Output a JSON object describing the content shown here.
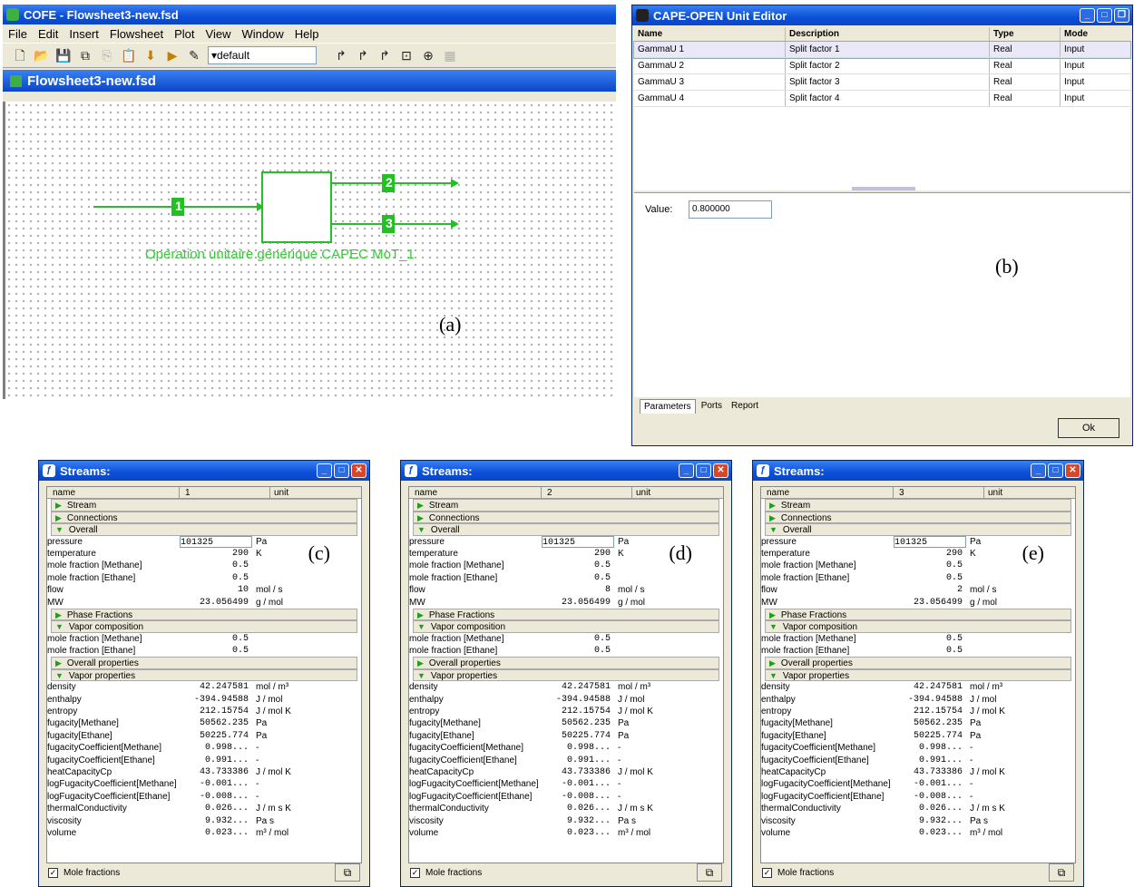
{
  "cofe": {
    "title": "COFE - Flowsheet3-new.fsd",
    "menu": [
      "File",
      "Edit",
      "Insert",
      "Flowsheet",
      "Plot",
      "View",
      "Window",
      "Help"
    ],
    "combo_value": "default",
    "doc_title": "Flowsheet3-new.fsd",
    "unit_label": "Opération unitaire générique CAPEC MoT_1",
    "stream_labels": [
      "1",
      "2",
      "3"
    ],
    "figure_label": "(a)"
  },
  "editor": {
    "title": "CAPE-OPEN Unit Editor",
    "columns": [
      "Name",
      "Description",
      "Type",
      "Mode"
    ],
    "rows": [
      {
        "name": "GammaU 1",
        "description": "Split factor 1",
        "type": "Real",
        "mode": "Input"
      },
      {
        "name": "GammaU 2",
        "description": "Split factor 2",
        "type": "Real",
        "mode": "Input"
      },
      {
        "name": "GammaU 3",
        "description": "Split factor 3",
        "type": "Real",
        "mode": "Input"
      },
      {
        "name": "GammaU 4",
        "description": "Split factor 4",
        "type": "Real",
        "mode": "Input"
      }
    ],
    "value_label": "Value:",
    "value": "0.800000",
    "tabs": [
      "Parameters",
      "Ports",
      "Report"
    ],
    "ok_label": "Ok",
    "figure_label": "(b)"
  },
  "streams": [
    {
      "title": "Streams:",
      "stream_id": "1",
      "figure_label": "(c)",
      "overall": {
        "pressure": "101325",
        "temperature": "290",
        "x_methane": "0.5",
        "x_ethane": "0.5",
        "flow": "10",
        "mw": "23.056499"
      },
      "vapor_comp": {
        "x_methane": "0.5",
        "x_ethane": "0.5"
      }
    },
    {
      "title": "Streams:",
      "stream_id": "2",
      "figure_label": "(d)",
      "overall": {
        "pressure": "101325",
        "temperature": "290",
        "x_methane": "0.5",
        "x_ethane": "0.5",
        "flow": "8",
        "mw": "23.056499"
      },
      "vapor_comp": {
        "x_methane": "0.5",
        "x_ethane": "0.5"
      }
    },
    {
      "title": "Streams:",
      "stream_id": "3",
      "figure_label": "(e)",
      "overall": {
        "pressure": "101325",
        "temperature": "290",
        "x_methane": "0.5",
        "x_ethane": "0.5",
        "flow": "2",
        "mw": "23.056499"
      },
      "vapor_comp": {
        "x_methane": "0.5",
        "x_ethane": "0.5"
      }
    }
  ],
  "stream_common": {
    "header": {
      "name": "name",
      "unit": "unit"
    },
    "sections": {
      "stream": "Stream",
      "connections": "Connections",
      "overall": "Overall",
      "phase_fractions": "Phase Fractions",
      "vapor_composition": "Vapor composition",
      "overall_properties": "Overall properties",
      "vapor_properties": "Vapor properties"
    },
    "overall_rows": [
      {
        "key": "pressure",
        "label": "pressure",
        "unit": "Pa"
      },
      {
        "key": "temperature",
        "label": "temperature",
        "unit": "K"
      },
      {
        "key": "x_methane",
        "label": "mole fraction [Methane]",
        "unit": ""
      },
      {
        "key": "x_ethane",
        "label": "mole fraction [Ethane]",
        "unit": ""
      },
      {
        "key": "flow",
        "label": "flow",
        "unit": "mol / s"
      },
      {
        "key": "mw",
        "label": "MW",
        "unit": "g / mol"
      }
    ],
    "vapor_comp_rows": [
      {
        "key": "x_methane",
        "label": "mole fraction [Methane]"
      },
      {
        "key": "x_ethane",
        "label": "mole fraction [Ethane]"
      }
    ],
    "vapor_props": [
      {
        "label": "density",
        "value": "42.247581",
        "unit": "mol / m³"
      },
      {
        "label": "enthalpy",
        "value": "-394.94588",
        "unit": "J / mol"
      },
      {
        "label": "entropy",
        "value": "212.15754",
        "unit": "J / mol K"
      },
      {
        "label": "fugacity[Methane]",
        "value": "50562.235",
        "unit": "Pa"
      },
      {
        "label": "fugacity[Ethane]",
        "value": "50225.774",
        "unit": "Pa"
      },
      {
        "label": "fugacityCoefficient[Methane]",
        "value": "0.998...",
        "unit": "-"
      },
      {
        "label": "fugacityCoefficient[Ethane]",
        "value": "0.991...",
        "unit": "-"
      },
      {
        "label": "heatCapacityCp",
        "value": "43.733386",
        "unit": "J / mol K"
      },
      {
        "label": "logFugacityCoefficient[Methane]",
        "value": "-0.001...",
        "unit": "-"
      },
      {
        "label": "logFugacityCoefficient[Ethane]",
        "value": "-0.008...",
        "unit": "-"
      },
      {
        "label": "thermalConductivity",
        "value": "0.026...",
        "unit": "J / m s K"
      },
      {
        "label": "viscosity",
        "value": "9.932...",
        "unit": "Pa s"
      },
      {
        "label": "volume",
        "value": "0.023...",
        "unit": "m³ / mol"
      }
    ],
    "footer_checkbox": "Mole fractions"
  },
  "colors": {
    "title_blue": "#0b4fd9",
    "stream_green": "#22c022",
    "label_green": "#33cc33"
  }
}
